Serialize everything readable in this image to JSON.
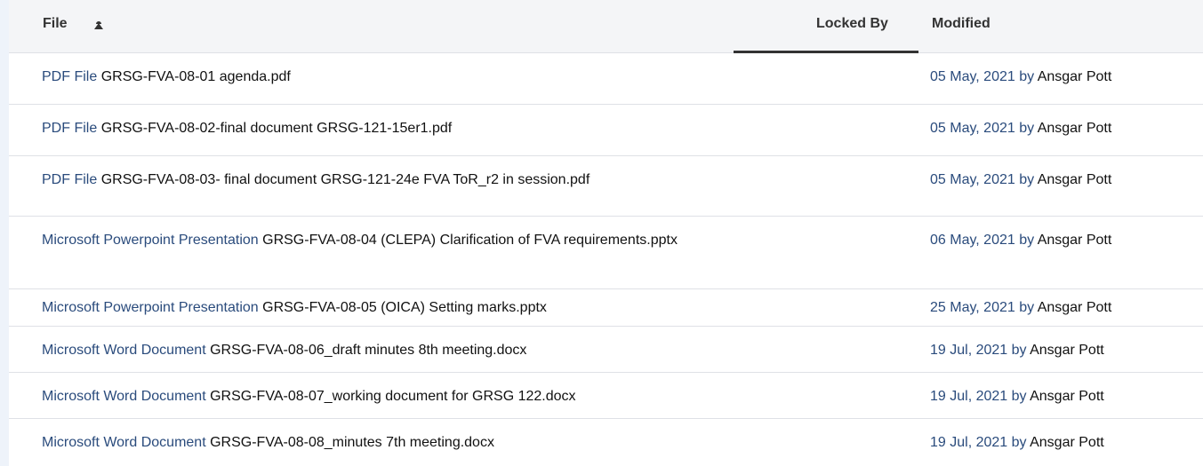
{
  "header": {
    "file_label": "File",
    "locked_label": "Locked By",
    "modified_label": "Modified"
  },
  "rows": [
    {
      "type": "PDF File",
      "name": "GRSG-FVA-08-01 agenda.pdf",
      "date": "05 May, 2021",
      "by": "by",
      "user": "Ansgar Pott"
    },
    {
      "type": "PDF File",
      "name": "GRSG-FVA-08-02-final document GRSG-121-15er1.pdf",
      "date": "05 May, 2021",
      "by": "by",
      "user": "Ansgar Pott"
    },
    {
      "type": "PDF File",
      "name": "GRSG-FVA-08-03- final document GRSG-121-24e FVA ToR_r2 in session.pdf",
      "date": "05 May, 2021",
      "by": "by",
      "user": "Ansgar Pott"
    },
    {
      "type": "Microsoft Powerpoint Presentation",
      "name": "GRSG-FVA-08-04 (CLEPA) Clarification of FVA requirements.pptx",
      "date": "06 May, 2021",
      "by": "by",
      "user": "Ansgar Pott"
    },
    {
      "type": "Microsoft Powerpoint Presentation",
      "name": "GRSG-FVA-08-05 (OICA) Setting marks.pptx",
      "date": "25 May, 2021",
      "by": "by",
      "user": "Ansgar Pott"
    },
    {
      "type": "Microsoft Word Document",
      "name": "GRSG-FVA-08-06_draft minutes 8th meeting.docx",
      "date": "19 Jul, 2021",
      "by": "by",
      "user": "Ansgar Pott"
    },
    {
      "type": "Microsoft Word Document",
      "name": "GRSG-FVA-08-07_working document for GRSG 122.docx",
      "date": "19 Jul, 2021",
      "by": "by",
      "user": "Ansgar Pott"
    },
    {
      "type": "Microsoft Word Document",
      "name": "GRSG-FVA-08-08_minutes 7th meeting.docx",
      "date": "19 Jul, 2021",
      "by": "by",
      "user": "Ansgar Pott"
    }
  ]
}
